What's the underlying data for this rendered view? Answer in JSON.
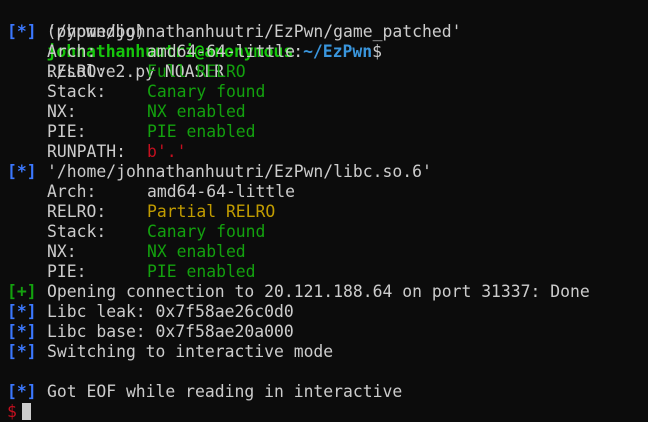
{
  "prompt": {
    "venv": "(pypwndbg)",
    "userhost": "johnathanhuutri@anonymous",
    "colon": ":",
    "path": "~/EzPwn",
    "dollar": "$",
    "command": "./solve2.py NOASLR"
  },
  "binary1": {
    "marker": "[*]",
    "path": "'/home/johnathanhuutri/EzPwn/game_patched'",
    "props": [
      {
        "key": "Arch:",
        "value": "amd64-64-little",
        "color": "#cccccc"
      },
      {
        "key": "RELRO:",
        "value": "Full RELRO",
        "color": "#13a10e"
      },
      {
        "key": "Stack:",
        "value": "Canary found",
        "color": "#13a10e"
      },
      {
        "key": "NX:",
        "value": "NX enabled",
        "color": "#13a10e"
      },
      {
        "key": "PIE:",
        "value": "PIE enabled",
        "color": "#13a10e"
      },
      {
        "key": "RUNPATH:",
        "value": "b'.'",
        "color": "#c50f1f"
      }
    ]
  },
  "binary2": {
    "marker": "[*]",
    "path": "'/home/johnathanhuutri/EzPwn/libc.so.6'",
    "props": [
      {
        "key": "Arch:",
        "value": "amd64-64-little",
        "color": "#cccccc"
      },
      {
        "key": "RELRO:",
        "value": "Partial RELRO",
        "color": "#c19c00"
      },
      {
        "key": "Stack:",
        "value": "Canary found",
        "color": "#13a10e"
      },
      {
        "key": "NX:",
        "value": "NX enabled",
        "color": "#13a10e"
      },
      {
        "key": "PIE:",
        "value": "PIE enabled",
        "color": "#13a10e"
      }
    ]
  },
  "log": [
    {
      "marker": "[+]",
      "marker_color": "#13a10e",
      "text": "Opening connection to 20.121.188.64 on port 31337: Done"
    },
    {
      "marker": "[*]",
      "marker_color": "#3b78ff",
      "text": "Libc leak: 0x7f58ae26c0d0"
    },
    {
      "marker": "[*]",
      "marker_color": "#3b78ff",
      "text": "Libc base: 0x7f58ae20a000"
    },
    {
      "marker": "[*]",
      "marker_color": "#3b78ff",
      "text": "Switching to interactive mode"
    }
  ],
  "eof": {
    "marker": "[*]",
    "text": "Got EOF while reading in interactive"
  },
  "shell_prompt": "$"
}
